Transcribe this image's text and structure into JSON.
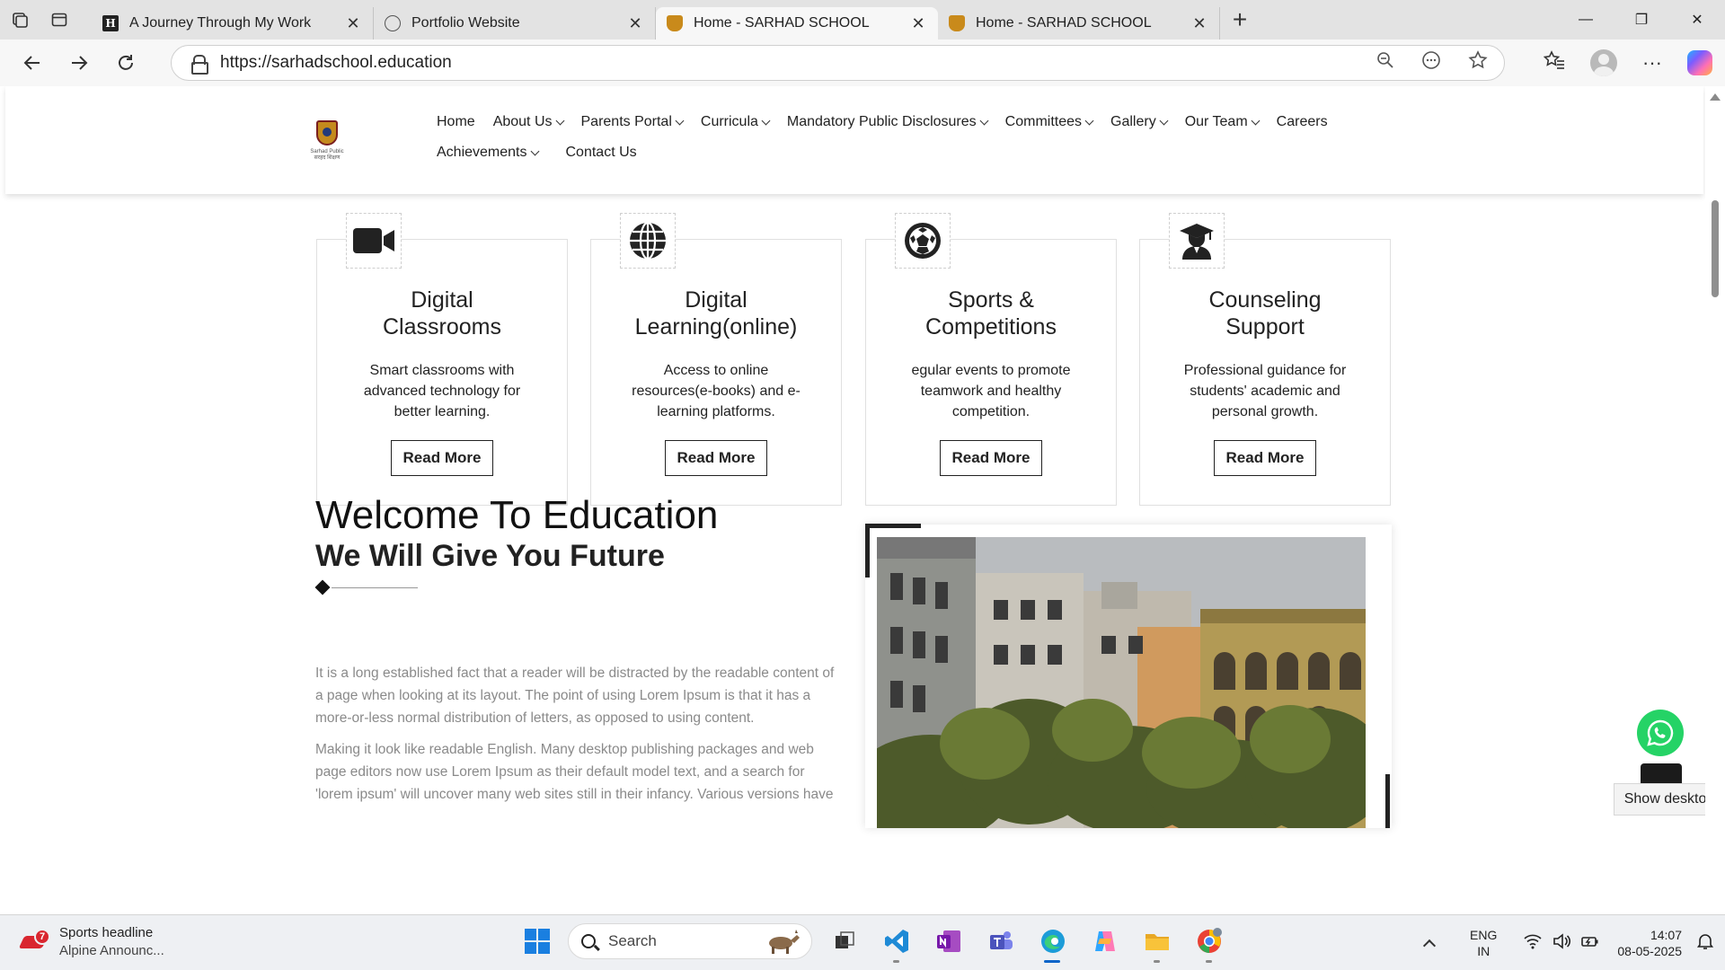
{
  "browser": {
    "tabs": [
      {
        "title": "A Journey Through My Work",
        "favicon": "h-icon",
        "active": false
      },
      {
        "title": "Portfolio Website",
        "favicon": "globe-icon",
        "active": false
      },
      {
        "title": "Home - SARHAD SCHOOL",
        "favicon": "school-crest-icon",
        "active": true
      },
      {
        "title": "Home - SARHAD SCHOOL",
        "favicon": "school-crest-icon",
        "active": false
      }
    ],
    "url": "https://sarhadschool.education"
  },
  "site": {
    "logo_caption_line1": "Sarhad Public",
    "logo_caption_line2": "सरहद शिक्षण",
    "nav": [
      {
        "label": "Home",
        "has_dropdown": false
      },
      {
        "label": "About Us",
        "has_dropdown": true
      },
      {
        "label": "Parents Portal",
        "has_dropdown": true
      },
      {
        "label": "Curricula",
        "has_dropdown": true
      },
      {
        "label": "Mandatory Public Disclosures",
        "has_dropdown": true
      },
      {
        "label": "Committees",
        "has_dropdown": true
      },
      {
        "label": "Gallery",
        "has_dropdown": true
      },
      {
        "label": "Our Team",
        "has_dropdown": true
      },
      {
        "label": "Careers",
        "has_dropdown": false
      },
      {
        "label": "Achievements",
        "has_dropdown": true
      },
      {
        "label": "Contact Us",
        "has_dropdown": false
      }
    ],
    "features": [
      {
        "icon": "video-camera-icon",
        "title_line1": "Digital",
        "title_line2": "Classrooms",
        "text": "Smart classrooms with advanced technology for better learning.",
        "button": "Read More"
      },
      {
        "icon": "globe-icon",
        "title_line1": "Digital",
        "title_line2": "Learning(online)",
        "text": "Access to online resources(e-books) and e-learning platforms.",
        "button": "Read More"
      },
      {
        "icon": "football-icon",
        "title_line1": "Sports &",
        "title_line2": "Competitions",
        "text": "egular events to promote teamwork and healthy competition.",
        "button": "Read More"
      },
      {
        "icon": "graduate-icon",
        "title_line1": "Counseling",
        "title_line2": "Support",
        "text": "Professional guidance for students' academic and personal growth.",
        "button": "Read More"
      }
    ],
    "welcome": {
      "heading": "Welcome To Education",
      "subheading": "We Will Give You Future",
      "paragraph1": "It is a long established fact that a reader will be distracted by the readable content of a page when looking at its layout. The point of using Lorem Ipsum is that it has a more-or-less normal distribution of letters, as opposed to using content.",
      "paragraph2": "Making it look like readable English. Many desktop publishing packages and web page editors now use Lorem Ipsum as their default model text, and a search for 'lorem ipsum' will uncover many web sites still in their infancy. Various versions have"
    },
    "tooltip": "Show desktop"
  },
  "taskbar": {
    "weather_badge": "7",
    "weather_title": "Sports headline",
    "weather_sub": "Alpine Announc...",
    "search_placeholder": "Search",
    "lang_line1": "ENG",
    "lang_line2": "IN",
    "time": "14:07",
    "date": "08-05-2025"
  },
  "colors": {
    "whatsapp": "#25d366",
    "windows_blue": "#1a7fe0",
    "muted_text": "#8a8a8a"
  }
}
